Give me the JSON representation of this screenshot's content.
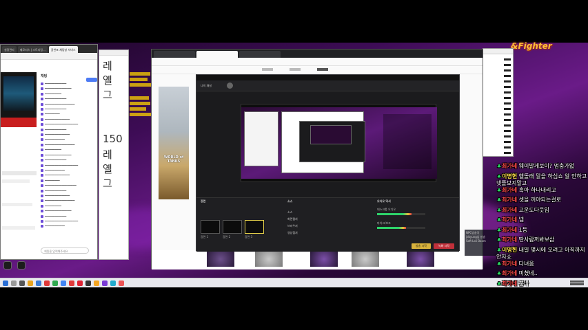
{
  "colors": {
    "chat_nick_red": "#ff4a4a",
    "chat_nick_yellow": "#ffe04a",
    "chat_nick_green": "#48ff6a",
    "overlay_gold": "#ffd400",
    "logo_orange": "#ffbf3a",
    "app_accent": "#e4d04a"
  },
  "logo": {
    "text": "&Fighter"
  },
  "left_browser": {
    "tabs": [
      "설정관리",
      "제모리스 | 스트리밍...",
      "글반포 채팅방 서비스"
    ],
    "chat_title": "채팅",
    "chat_lines_label": "채팅",
    "chat_input_placeholder": "채팅을 입력해주세요"
  },
  "doc_window": {
    "lines_big": [
      "레",
      "옐",
      "그",
      "150",
      "레",
      "옐",
      "그"
    ]
  },
  "main_browser": {
    "banner_text": "WORLD of TANKS"
  },
  "app_window": {
    "header_label": "나의 채널",
    "panels": {
      "scenes": "장면",
      "sources": "소스",
      "mixer": "오디오 믹서"
    },
    "scenes": [
      "장면 1",
      "장면 2",
      "장면 3"
    ],
    "sources": [
      "소스",
      "화면캡처",
      "브라우저",
      "영상캡처"
    ],
    "mixer_channels": [
      {
        "label": "데스크톱 오디오",
        "level": 0.72
      },
      {
        "label": "마이크/보조",
        "level": 0.6
      }
    ],
    "buttons": {
      "start_stream": "방송 시작",
      "record": "녹화 시작"
    }
  },
  "viewer_box": {
    "lines": [
      "NPC방송국",
      "jdkyung님 방송",
      "Soft Loli Boom"
    ]
  },
  "chat": [
    {
      "badge": "♣",
      "nick": "최가네",
      "nick_color": "red",
      "msg": "웨이발게보이? 멈춤가없"
    },
    {
      "badge": "♣",
      "nick": "이명헌",
      "nick_color": "yellow",
      "msg": "헬돌래 말을 하십쇼 알 안하고 넷플보지말고"
    },
    {
      "badge": "♣",
      "nick": "최가네",
      "nick_color": "red",
      "msg": "혹아 하나내리고"
    },
    {
      "badge": "♣",
      "nick": "최가네",
      "nick_color": "red",
      "msg": "셋을 꺼야되는걸로"
    },
    {
      "badge": "♣",
      "nick": "최가네",
      "nick_color": "red",
      "msg": "고운도다웃임"
    },
    {
      "badge": "♣",
      "nick": "최가네",
      "nick_color": "red",
      "msg": "넵"
    },
    {
      "badge": "♣",
      "nick": "최가네",
      "nick_color": "red",
      "msg": "1등"
    },
    {
      "badge": "♣",
      "nick": "최가네",
      "nick_color": "red",
      "msg": "딴사람꺼봐보삼"
    },
    {
      "badge": "♣",
      "nick": "이명헌",
      "nick_color": "yellow",
      "msg": "내일 몇시에 오려고 아직까지 안자쇼"
    },
    {
      "badge": "♣",
      "nick": "최가네",
      "nick_color": "red",
      "msg": "다녀옴"
    },
    {
      "badge": "♣",
      "nick": "최가네",
      "nick_color": "red",
      "msg": "미쳤네.."
    },
    {
      "badge": "♣",
      "nick": "최가네",
      "nick_color": "red",
      "msg": "뿡바"
    },
    {
      "badge": "♣",
      "nick": "이명헌",
      "nick_color": "green",
      "msg": "뿡바"
    }
  ]
}
